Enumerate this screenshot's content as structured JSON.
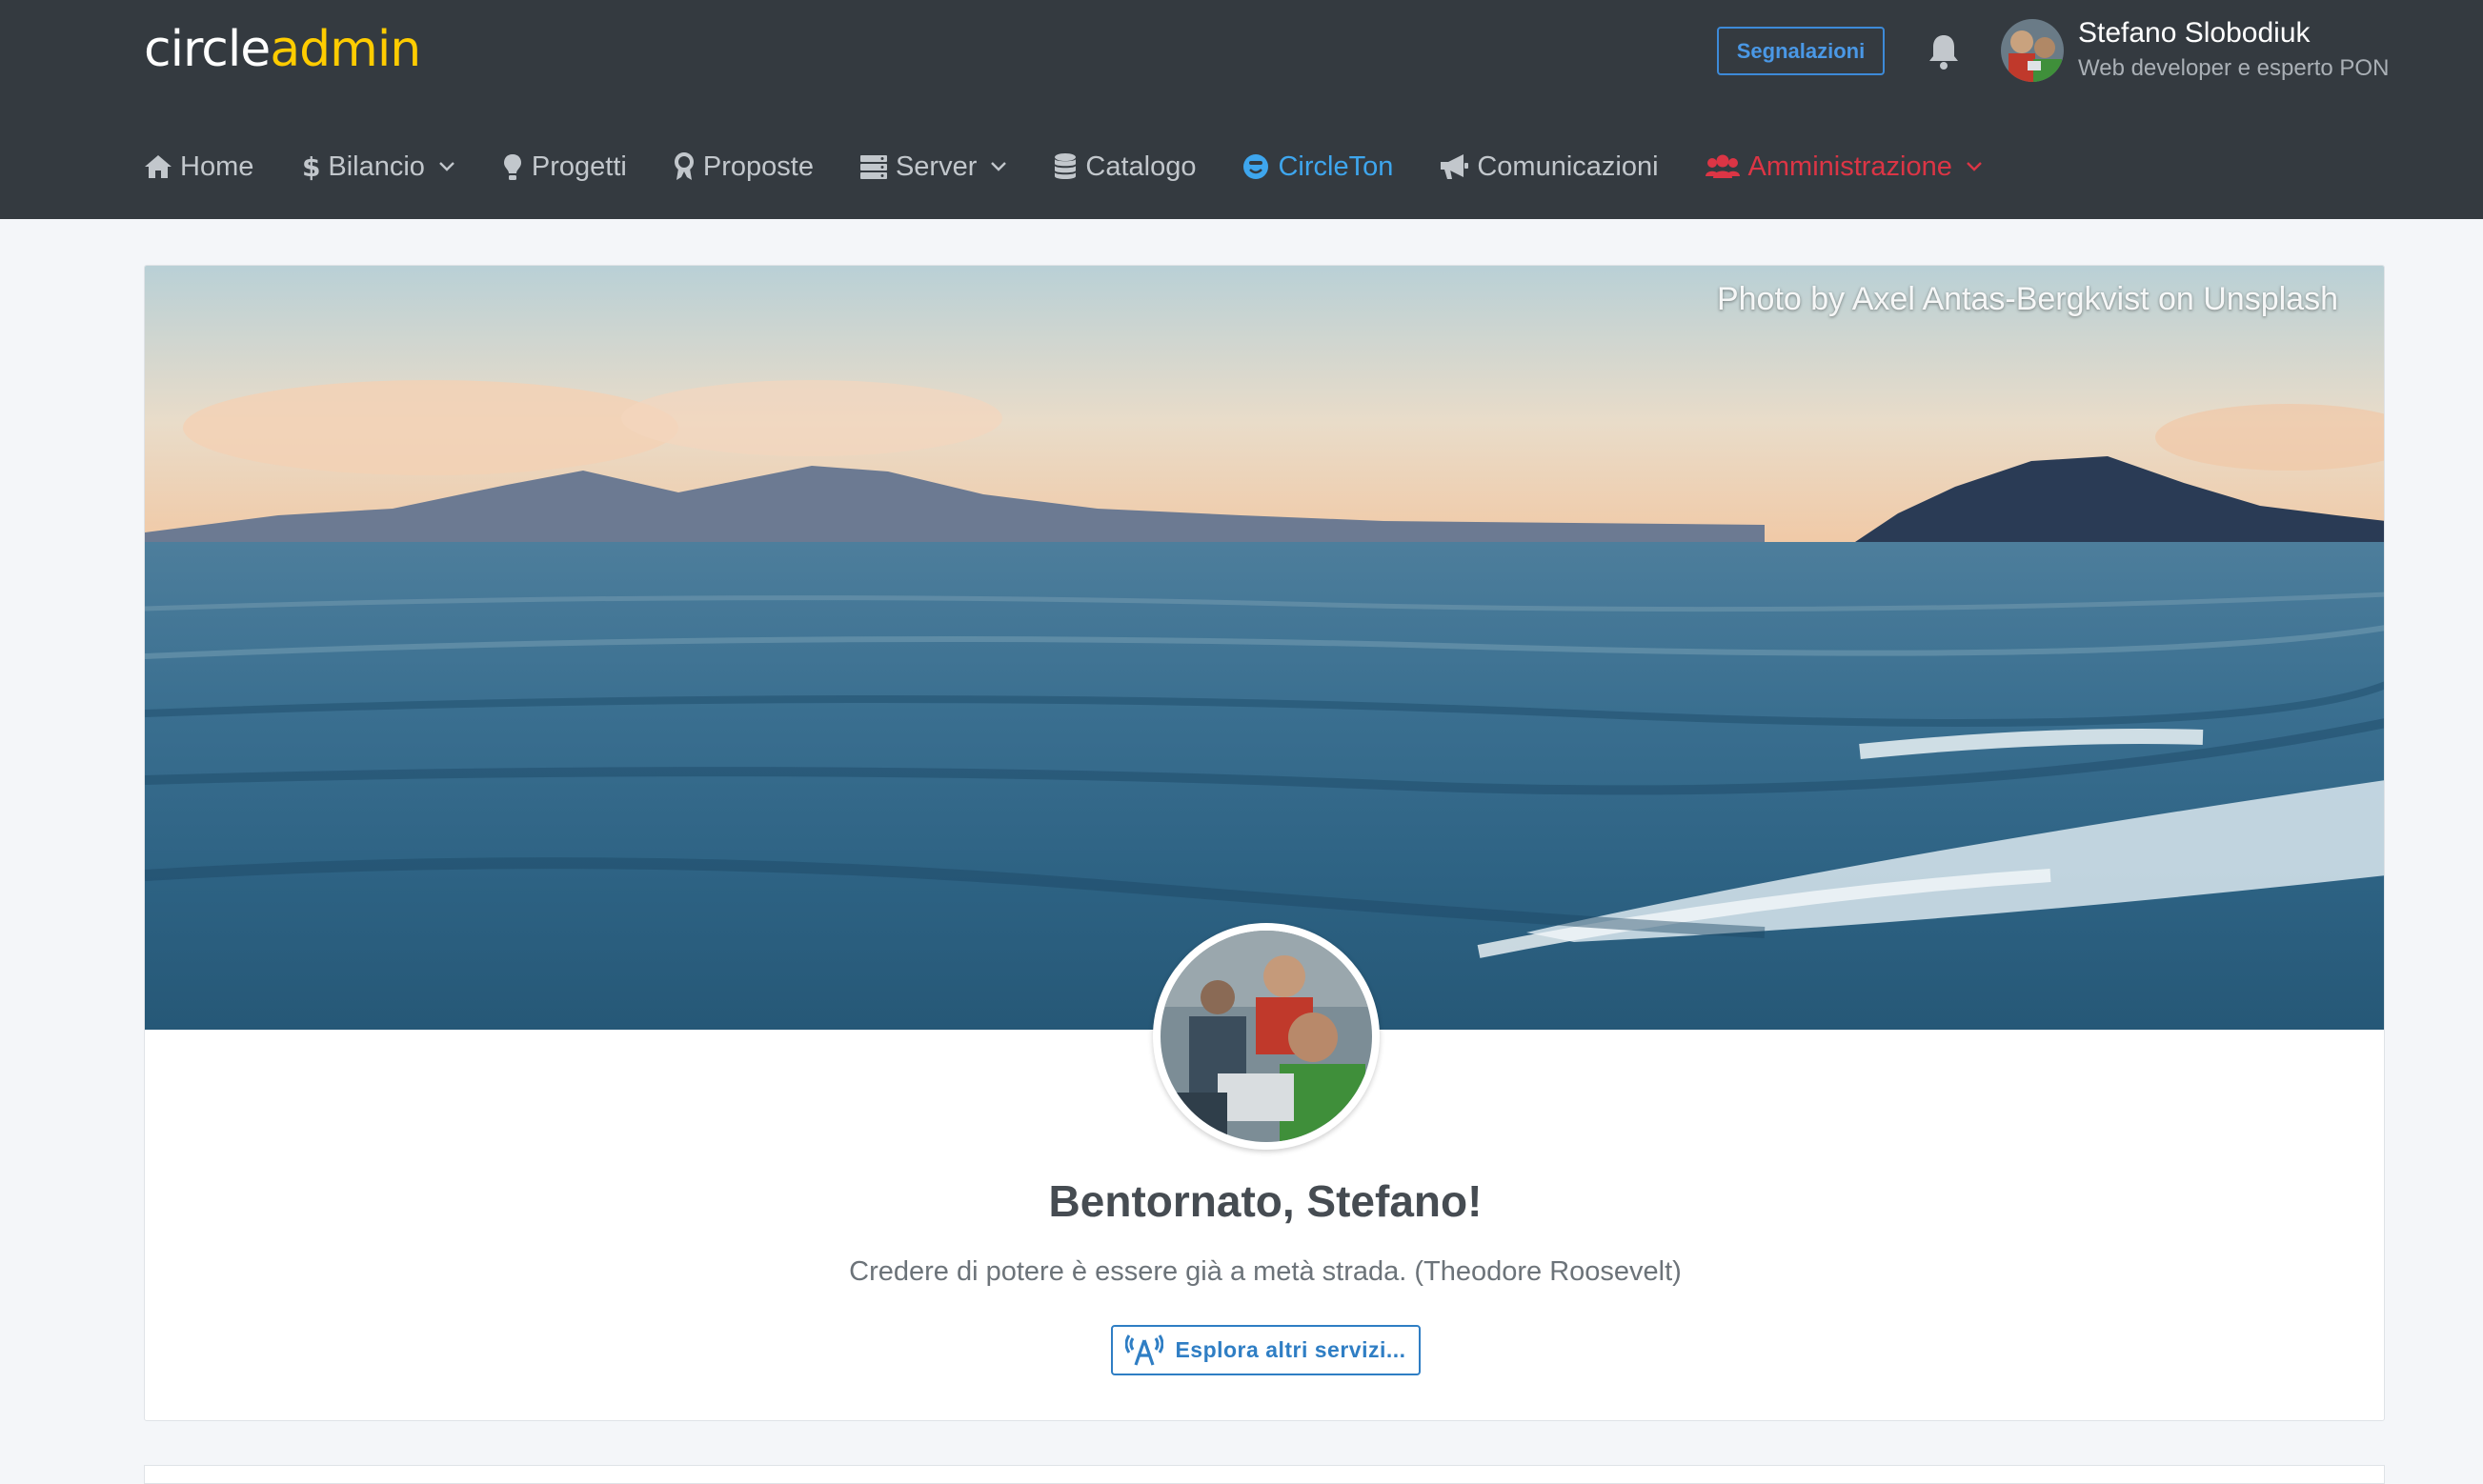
{
  "brand": {
    "part1": "circle",
    "part2": "admin"
  },
  "header": {
    "report_button": "Segnalazioni",
    "user_name": "Stefano Slobodiuk",
    "user_role": "Web developer e esperto PON"
  },
  "nav": {
    "items": [
      {
        "label": "Home",
        "icon": "home-icon"
      },
      {
        "label": "Bilancio",
        "icon": "dollar-icon",
        "dropdown": true
      },
      {
        "label": "Progetti",
        "icon": "lightbulb-icon"
      },
      {
        "label": "Proposte",
        "icon": "award-icon"
      },
      {
        "label": "Server",
        "icon": "server-icon",
        "dropdown": true
      },
      {
        "label": "Catalogo",
        "icon": "database-icon"
      },
      {
        "label": "CircleTon",
        "icon": "smile-icon",
        "active": true
      },
      {
        "label": "Comunicazioni",
        "icon": "megaphone-icon"
      },
      {
        "label": "Amministrazione",
        "icon": "users-icon",
        "dropdown": true
      }
    ]
  },
  "hero": {
    "credit": "Photo by Axel Antas-Bergkvist on Unsplash"
  },
  "welcome": {
    "title": "Bentornato, Stefano!",
    "quote": "Credere di potere è essere già a metà strada. (Theodore Roosevelt)",
    "explore_button": "Esplora altri servizi..."
  },
  "colors": {
    "topbar": "#343a40",
    "brand_accent": "#ffcc00",
    "active_nav": "#3ea6ee",
    "admin_nav": "#dc3545",
    "primary": "#2f7ec4"
  }
}
